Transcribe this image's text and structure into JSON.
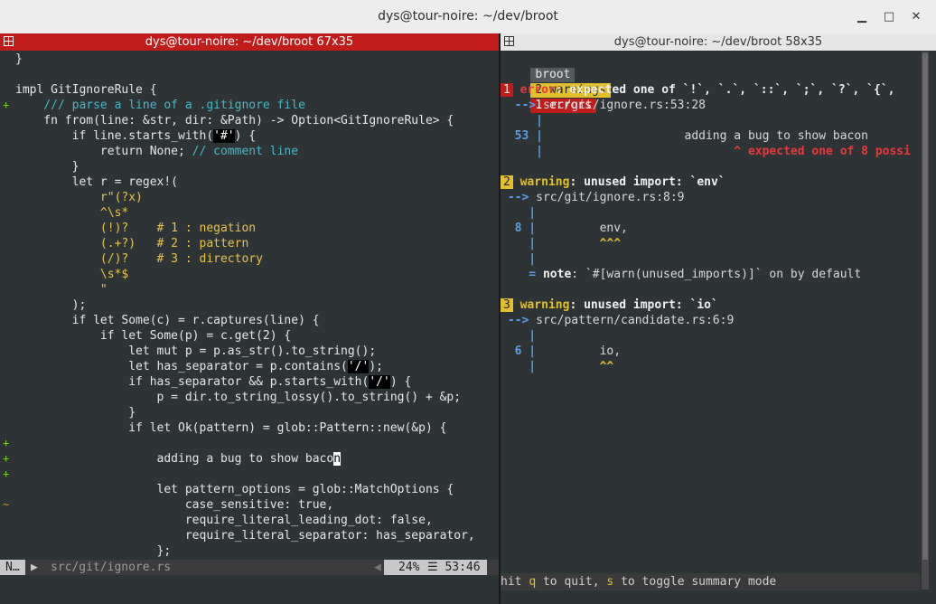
{
  "window": {
    "title": "dys@tour-noire: ~/dev/broot",
    "min": "▁",
    "max": "□",
    "close": "✕"
  },
  "left_pane": {
    "title": "dys@tour-noire: ~/dev/broot 67x35",
    "lines": [
      {
        "g": "",
        "t": "}"
      },
      {
        "g": "",
        "t": ""
      },
      {
        "g": "",
        "t": "impl GitIgnoreRule {"
      },
      {
        "g": "+",
        "t": "    /// parse a line of a .gitignore file",
        "cls": "c-comment"
      },
      {
        "g": "",
        "t": "    fn from(line: &str, dir: &Path) -> Option<GitIgnoreRule> {"
      },
      {
        "g": "",
        "t": "        if line.starts_with('#') {"
      },
      {
        "g": "",
        "t": "            return None; // comment line"
      },
      {
        "g": "",
        "t": "        }"
      },
      {
        "g": "",
        "t": "        let r = regex!("
      },
      {
        "g": "",
        "t": "            r\"(?x)",
        "cls": "c-str"
      },
      {
        "g": "",
        "t": "            ^\\s*",
        "cls": "c-str"
      },
      {
        "g": "",
        "t": "            (!)?    # 1 : negation",
        "cls": "c-str"
      },
      {
        "g": "",
        "t": "            (.+?)   # 2 : pattern",
        "cls": "c-str"
      },
      {
        "g": "",
        "t": "            (/)?    # 3 : directory",
        "cls": "c-str"
      },
      {
        "g": "",
        "t": "            \\s*$",
        "cls": "c-str"
      },
      {
        "g": "",
        "t": "            \"",
        "cls": "c-str"
      },
      {
        "g": "",
        "t": "        );"
      },
      {
        "g": "",
        "t": "        if let Some(c) = r.captures(line) {"
      },
      {
        "g": "",
        "t": "            if let Some(p) = c.get(2) {"
      },
      {
        "g": "",
        "t": "                let mut p = p.as_str().to_string();"
      },
      {
        "g": "",
        "t": "                let has_separator = p.contains('/');"
      },
      {
        "g": "",
        "t": "                if has_separator && p.starts_with('/') {"
      },
      {
        "g": "",
        "t": "                    p = dir.to_string_lossy().to_string() + &p;"
      },
      {
        "g": "",
        "t": "                }"
      },
      {
        "g": "",
        "t": "                if let Ok(pattern) = glob::Pattern::new(&p) {"
      },
      {
        "g": "+",
        "t": ""
      },
      {
        "g": "+",
        "t": "                    adding a bug to show bacon"
      },
      {
        "g": "+",
        "t": ""
      },
      {
        "g": "",
        "t": "                    let pattern_options = glob::MatchOptions {"
      },
      {
        "g": "~",
        "t": "                        case_sensitive: true,"
      },
      {
        "g": "",
        "t": "                        require_literal_leading_dot: false,"
      },
      {
        "g": "",
        "t": "                        require_literal_separator: has_separator,"
      },
      {
        "g": "",
        "t": "                    };"
      }
    ],
    "status": {
      "mode": "N…",
      "path": "src/git/ignore.rs",
      "percent": "24%",
      "position": "☰ 53:46"
    }
  },
  "right_pane": {
    "title": "dys@tour-noire: ~/dev/broot 58x35",
    "badges": {
      "project": "broot",
      "warnings": "2 warnings",
      "errors": "1 errors"
    },
    "help": {
      "p1": "hit ",
      "k1": "q",
      "p2": " to quit, ",
      "k2": "s",
      "p3": " to toggle summary mode"
    }
  },
  "colors": {
    "accent_red": "#c01c1c",
    "warning_yellow": "#e2c02b",
    "background": "#2e3436"
  }
}
